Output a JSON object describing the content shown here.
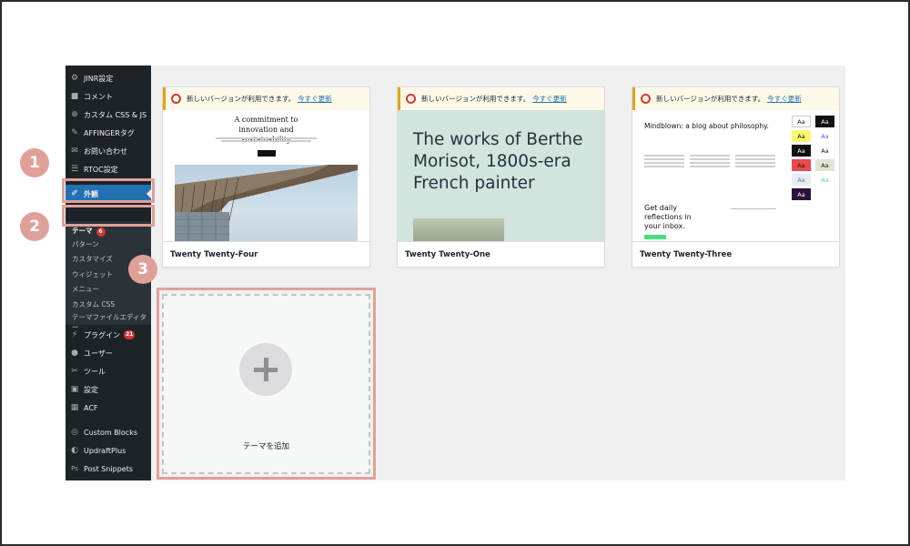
{
  "sidebar": {
    "items": [
      {
        "label": "JINR設定",
        "icon": "gear-icon"
      },
      {
        "label": "コメント",
        "icon": "comment-icon"
      },
      {
        "label": "カスタム CSS & JS",
        "icon": "plus-circle-icon"
      },
      {
        "label": "AFFINGERタグ",
        "icon": "pin-icon"
      },
      {
        "label": "お問い合わせ",
        "icon": "mail-icon"
      },
      {
        "label": "RTOC設定",
        "icon": "list-icon"
      },
      {
        "label": "外観",
        "icon": "paintbrush-icon"
      },
      {
        "label": "プラグイン",
        "icon": "plugin-icon",
        "badge": "21"
      },
      {
        "label": "ユーザー",
        "icon": "user-icon"
      },
      {
        "label": "ツール",
        "icon": "wrench-icon"
      },
      {
        "label": "設定",
        "icon": "settings-icon"
      },
      {
        "label": "ACF",
        "icon": "grid-icon"
      },
      {
        "label": "Custom Blocks",
        "icon": "blocks-icon"
      },
      {
        "label": "UpdraftPlus",
        "icon": "updraft-icon"
      },
      {
        "label": "Post Snippets",
        "icon": "ps-icon"
      }
    ],
    "submenu": {
      "current": {
        "label": "テーマ",
        "badge": "6"
      },
      "items": [
        "パターン",
        "カスタマイズ",
        "ウィジェット",
        "メニュー",
        "カスタム CSS",
        "テーマファイルエディター"
      ]
    }
  },
  "markers": [
    "1",
    "2",
    "3"
  ],
  "update_notice": {
    "text": "新しいバージョンが利用できます。",
    "link": "今すぐ更新"
  },
  "themes": [
    {
      "name": "Twenty Twenty-Four",
      "headline": "A commitment to innovation and sustainability"
    },
    {
      "name": "Twenty Twenty-One",
      "headline": "The works of Berthe Morisot, 1800s-era French painter"
    },
    {
      "name": "Twenty Twenty-Three",
      "headline": "Mindblown: a blog about philosophy.",
      "subhead": "Get daily reflections in your inbox.",
      "swatch_label": "Aa"
    }
  ],
  "add_theme": {
    "label": "テーマを追加"
  },
  "colors": {
    "sidebar_bg": "#1d2327",
    "active_bg": "#2271b1",
    "highlight": "#e0a09a",
    "notice_border": "#dba617",
    "badge": "#d63638",
    "tt1_bg": "#d1e4dd"
  }
}
